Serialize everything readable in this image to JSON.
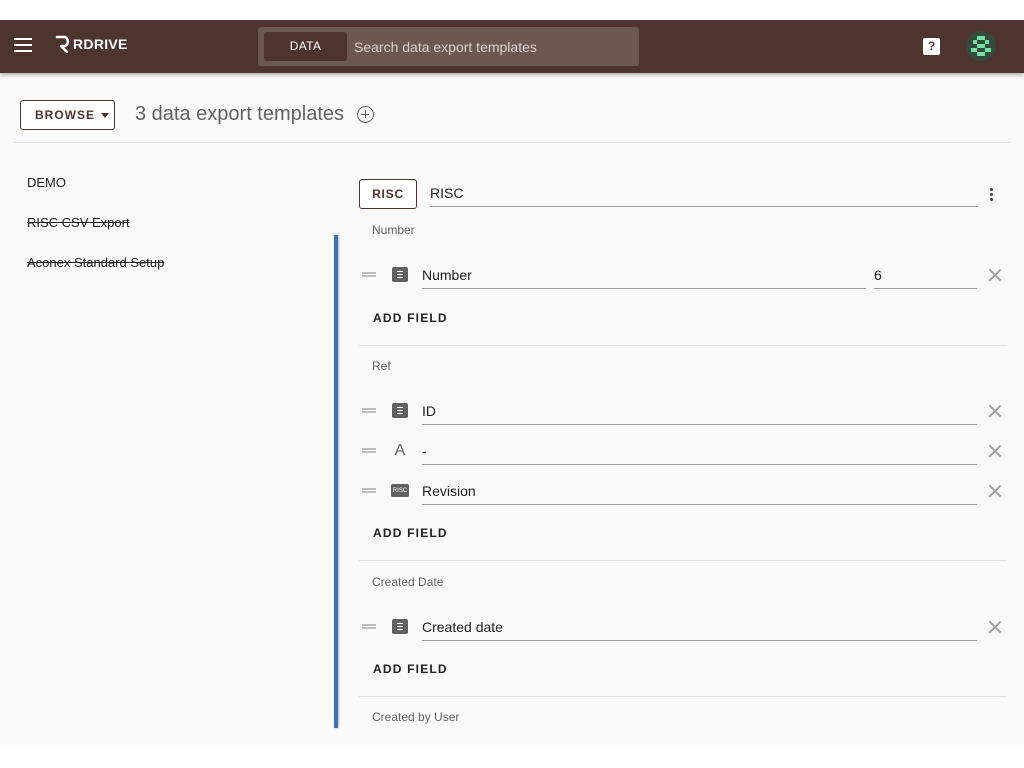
{
  "topbar": {
    "logo_text": "RDRIVE",
    "search_scope": "DATA",
    "search_placeholder": "Search data export templates",
    "help_label": "?",
    "colors": {
      "bar": "#4e342e",
      "search_bg": "#6d5751"
    }
  },
  "header": {
    "browse_label": "BROWSE",
    "title": "3 data export templates"
  },
  "sidebar": {
    "items": [
      {
        "label": "DEMO"
      },
      {
        "label": "RISC CSV Export"
      },
      {
        "label": "Aconex Standard Setup"
      }
    ],
    "accent_color": "#3f6fb8"
  },
  "editor": {
    "type_button": "RISC",
    "template_name": "RISC",
    "add_field_label": "ADD FIELD",
    "sections": [
      {
        "label": "Number",
        "fields": [
          {
            "icon": "number-icon",
            "value": "Number",
            "extra": "6"
          }
        ]
      },
      {
        "label": "Ref",
        "fields": [
          {
            "icon": "number-icon",
            "value": "ID"
          },
          {
            "icon": "text-icon",
            "icon_glyph": "A",
            "value": "-"
          },
          {
            "icon": "risc-icon",
            "icon_glyph": "RISC",
            "value": "Revision"
          }
        ]
      },
      {
        "label": "Created Date",
        "fields": [
          {
            "icon": "number-icon",
            "value": "Created date"
          }
        ]
      },
      {
        "label": "Created by User",
        "fields": []
      }
    ]
  }
}
